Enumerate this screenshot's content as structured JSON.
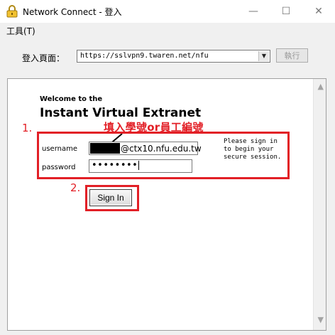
{
  "window": {
    "title": "Network Connect - 登入",
    "app_icon": "padlock-icon",
    "controls": {
      "minimize": "—",
      "maximize": "☐",
      "close": "✕"
    }
  },
  "menubar": {
    "tools": "工具(T)"
  },
  "toolbar": {
    "login_page_label": "登入頁面：",
    "url_value": "https://sslvpn9.twaren.net/nfu",
    "dropdown_icon": "chevron-down-icon",
    "execute_label": "執行"
  },
  "page": {
    "welcome": "Welcome to the",
    "product": "Instant Virtual Extranet",
    "username_label": "username",
    "username_value": "@ctx10.nfu.edu.tw",
    "password_label": "password",
    "password_value": "••••••••",
    "signin_note": "Please sign in to begin your secure session.",
    "signin_button": "Sign In"
  },
  "annotations": {
    "step1": "1.",
    "step2": "2.",
    "hint": "填入學號or員工編號",
    "color": "#e21f26"
  },
  "scrollbar": {
    "up": "▲",
    "down": "▼"
  }
}
